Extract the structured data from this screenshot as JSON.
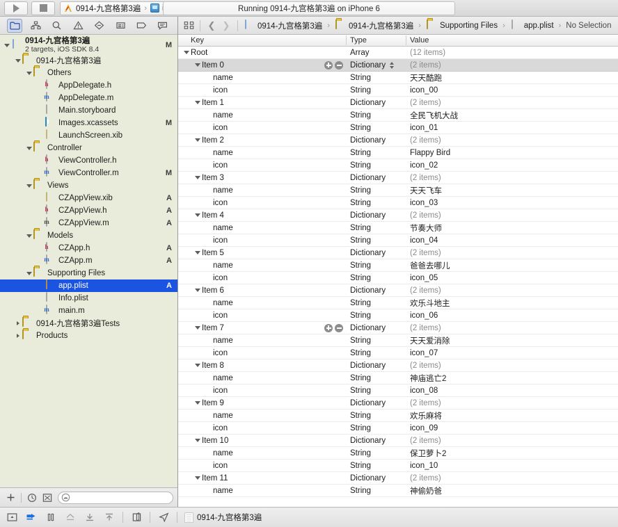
{
  "toolbar": {
    "run_label": "run-button",
    "stop_label": "stop-button",
    "scheme_project": "0914-九宫格第3遍",
    "scheme_destination": "iPhone 6",
    "status_text": "Running 0914-九宫格第3遍 on iPhone 6"
  },
  "navigator": {
    "tabs": [
      {
        "name": "project-navigator",
        "icon": "folder-icon"
      },
      {
        "name": "symbol-navigator",
        "icon": "symbol-icon"
      },
      {
        "name": "find-navigator",
        "icon": "search-icon"
      },
      {
        "name": "issue-navigator",
        "icon": "warning-icon"
      },
      {
        "name": "test-navigator",
        "icon": "diamond-icon"
      },
      {
        "name": "debug-navigator",
        "icon": "debug-icon"
      },
      {
        "name": "breakpoint-navigator",
        "icon": "breakpoint-icon"
      },
      {
        "name": "report-navigator",
        "icon": "report-icon"
      }
    ],
    "tree": [
      {
        "label": "0914-九宫格第3遍",
        "sub": "2 targets, iOS SDK 8.4",
        "indent": 0,
        "icon": "project-icon",
        "disclosure": "open",
        "status": "M",
        "bold": true
      },
      {
        "label": "0914-九宫格第3遍",
        "indent": 1,
        "icon": "folder-icon",
        "disclosure": "open",
        "status": ""
      },
      {
        "label": "Others",
        "indent": 2,
        "icon": "folder-icon",
        "disclosure": "open",
        "status": ""
      },
      {
        "label": "AppDelegate.h",
        "indent": 3,
        "icon": "h-file-icon",
        "disclosure": "none",
        "status": ""
      },
      {
        "label": "AppDelegate.m",
        "indent": 3,
        "icon": "m-file-icon",
        "disclosure": "none",
        "status": ""
      },
      {
        "label": "Main.storyboard",
        "indent": 3,
        "icon": "storyboard-icon",
        "disclosure": "none",
        "status": ""
      },
      {
        "label": "Images.xcassets",
        "indent": 3,
        "icon": "xcassets-icon",
        "disclosure": "none",
        "status": "M"
      },
      {
        "label": "LaunchScreen.xib",
        "indent": 3,
        "icon": "xib-icon",
        "disclosure": "none",
        "status": ""
      },
      {
        "label": "Controller",
        "indent": 2,
        "icon": "folder-icon",
        "disclosure": "open",
        "status": ""
      },
      {
        "label": "ViewController.h",
        "indent": 3,
        "icon": "h-file-icon",
        "disclosure": "none",
        "status": ""
      },
      {
        "label": "ViewController.m",
        "indent": 3,
        "icon": "m-file-icon",
        "disclosure": "none",
        "status": "M"
      },
      {
        "label": "Views",
        "indent": 2,
        "icon": "folder-icon",
        "disclosure": "open",
        "status": ""
      },
      {
        "label": "CZAppView.xib",
        "indent": 3,
        "icon": "xib-icon",
        "disclosure": "none",
        "status": "A"
      },
      {
        "label": "CZAppView.h",
        "indent": 3,
        "icon": "h-file-icon",
        "disclosure": "none",
        "status": "A"
      },
      {
        "label": "CZAppView.m",
        "indent": 3,
        "icon": "m-dark-icon",
        "disclosure": "none",
        "status": "A"
      },
      {
        "label": "Models",
        "indent": 2,
        "icon": "folder-icon",
        "disclosure": "open",
        "status": ""
      },
      {
        "label": "CZApp.h",
        "indent": 3,
        "icon": "h-file-icon",
        "disclosure": "none",
        "status": "A"
      },
      {
        "label": "CZApp.m",
        "indent": 3,
        "icon": "m-file-icon",
        "disclosure": "none",
        "status": "A"
      },
      {
        "label": "Supporting Files",
        "indent": 2,
        "icon": "folder-icon",
        "disclosure": "open",
        "status": ""
      },
      {
        "label": "app.plist",
        "indent": 3,
        "icon": "plist-icon",
        "disclosure": "none",
        "status": "A",
        "selected": true
      },
      {
        "label": "Info.plist",
        "indent": 3,
        "icon": "plist-gray-icon",
        "disclosure": "none",
        "status": ""
      },
      {
        "label": "main.m",
        "indent": 3,
        "icon": "m-file-icon",
        "disclosure": "none",
        "status": ""
      },
      {
        "label": "0914-九宫格第3遍Tests",
        "indent": 1,
        "icon": "folder-icon",
        "disclosure": "closed",
        "status": ""
      },
      {
        "label": "Products",
        "indent": 1,
        "icon": "folder-icon",
        "disclosure": "closed",
        "status": ""
      }
    ],
    "footer": {
      "add_label": "+",
      "recent_icon": "clock-icon",
      "filter_icon": "source-control-filter-icon",
      "filter_placeholder": ""
    }
  },
  "editor": {
    "jumpbar": {
      "related_icon": "related-items-icon",
      "back_icon": "back-arrow-icon",
      "forward_icon": "forward-arrow-icon",
      "breadcrumbs": [
        {
          "label": "0914-九宫格第3遍",
          "icon": "project-icon"
        },
        {
          "label": "0914-九宫格第3遍",
          "icon": "folder-icon"
        },
        {
          "label": "Supporting Files",
          "icon": "folder-icon"
        },
        {
          "label": "app.plist",
          "icon": "plist-gray-icon"
        },
        {
          "label": "No Selection",
          "icon": "none"
        }
      ]
    },
    "columns": {
      "key": "Key",
      "type": "Type",
      "value": "Value"
    },
    "rows": [
      {
        "key": "Root",
        "indent": 0,
        "type": "Array",
        "value": "(12 items)",
        "disclosure": "open",
        "muted": true
      },
      {
        "key": "Item 0",
        "indent": 1,
        "type": "Dictionary",
        "value": "(2 items)",
        "disclosure": "open",
        "muted": true,
        "highlight": true,
        "buttons": true,
        "stepper": true
      },
      {
        "key": "name",
        "indent": 2,
        "type": "String",
        "value": "天天酷跑"
      },
      {
        "key": "icon",
        "indent": 2,
        "type": "String",
        "value": "icon_00"
      },
      {
        "key": "Item 1",
        "indent": 1,
        "type": "Dictionary",
        "value": "(2 items)",
        "disclosure": "open",
        "muted": true
      },
      {
        "key": "name",
        "indent": 2,
        "type": "String",
        "value": "全民飞机大战"
      },
      {
        "key": "icon",
        "indent": 2,
        "type": "String",
        "value": "icon_01"
      },
      {
        "key": "Item 2",
        "indent": 1,
        "type": "Dictionary",
        "value": "(2 items)",
        "disclosure": "open",
        "muted": true
      },
      {
        "key": "name",
        "indent": 2,
        "type": "String",
        "value": "Flappy Bird"
      },
      {
        "key": "icon",
        "indent": 2,
        "type": "String",
        "value": "icon_02"
      },
      {
        "key": "Item 3",
        "indent": 1,
        "type": "Dictionary",
        "value": "(2 items)",
        "disclosure": "open",
        "muted": true
      },
      {
        "key": "name",
        "indent": 2,
        "type": "String",
        "value": "天天飞车"
      },
      {
        "key": "icon",
        "indent": 2,
        "type": "String",
        "value": "icon_03"
      },
      {
        "key": "Item 4",
        "indent": 1,
        "type": "Dictionary",
        "value": "(2 items)",
        "disclosure": "open",
        "muted": true
      },
      {
        "key": "name",
        "indent": 2,
        "type": "String",
        "value": "节奏大师"
      },
      {
        "key": "icon",
        "indent": 2,
        "type": "String",
        "value": "icon_04"
      },
      {
        "key": "Item 5",
        "indent": 1,
        "type": "Dictionary",
        "value": "(2 items)",
        "disclosure": "open",
        "muted": true
      },
      {
        "key": "name",
        "indent": 2,
        "type": "String",
        "value": "爸爸去哪儿"
      },
      {
        "key": "icon",
        "indent": 2,
        "type": "String",
        "value": "icon_05"
      },
      {
        "key": "Item 6",
        "indent": 1,
        "type": "Dictionary",
        "value": "(2 items)",
        "disclosure": "open",
        "muted": true
      },
      {
        "key": "name",
        "indent": 2,
        "type": "String",
        "value": "欢乐斗地主"
      },
      {
        "key": "icon",
        "indent": 2,
        "type": "String",
        "value": "icon_06"
      },
      {
        "key": "Item 7",
        "indent": 1,
        "type": "Dictionary",
        "value": "(2 items)",
        "disclosure": "open",
        "muted": true,
        "buttons": true
      },
      {
        "key": "name",
        "indent": 2,
        "type": "String",
        "value": "天天爱消除"
      },
      {
        "key": "icon",
        "indent": 2,
        "type": "String",
        "value": "icon_07"
      },
      {
        "key": "Item 8",
        "indent": 1,
        "type": "Dictionary",
        "value": "(2 items)",
        "disclosure": "open",
        "muted": true
      },
      {
        "key": "name",
        "indent": 2,
        "type": "String",
        "value": "神庙逃亡2"
      },
      {
        "key": "icon",
        "indent": 2,
        "type": "String",
        "value": "icon_08"
      },
      {
        "key": "Item 9",
        "indent": 1,
        "type": "Dictionary",
        "value": "(2 items)",
        "disclosure": "open",
        "muted": true
      },
      {
        "key": "name",
        "indent": 2,
        "type": "String",
        "value": "欢乐麻将"
      },
      {
        "key": "icon",
        "indent": 2,
        "type": "String",
        "value": "icon_09"
      },
      {
        "key": "Item 10",
        "indent": 1,
        "type": "Dictionary",
        "value": "(2 items)",
        "disclosure": "open",
        "muted": true
      },
      {
        "key": "name",
        "indent": 2,
        "type": "String",
        "value": "保卫萝卜2"
      },
      {
        "key": "icon",
        "indent": 2,
        "type": "String",
        "value": "icon_10"
      },
      {
        "key": "Item 11",
        "indent": 1,
        "type": "Dictionary",
        "value": "(2 items)",
        "disclosure": "open",
        "muted": true
      },
      {
        "key": "name",
        "indent": 2,
        "type": "String",
        "value": "神偷奶爸"
      }
    ]
  },
  "debugbar": {
    "buttons": [
      {
        "name": "hide-debug-area-button",
        "icon": "debug-area-icon"
      },
      {
        "name": "step-over-button",
        "icon": "step-over-icon"
      },
      {
        "name": "pause-button",
        "icon": "pause-icon"
      },
      {
        "name": "step-into-button",
        "icon": "step-into-icon"
      },
      {
        "name": "step-out-button",
        "icon": "step-out-icon"
      },
      {
        "name": "step-up-button",
        "icon": "step-up-icon"
      },
      {
        "name": "view-hierarchy-button",
        "icon": "view-hierarchy-icon"
      },
      {
        "name": "simulate-location-button",
        "icon": "location-arrow-icon"
      }
    ],
    "process_label": "0914-九宫格第3遍"
  },
  "colors": {
    "selection_blue": "#1b54e0",
    "navigator_bg": "#e9ecda",
    "row_highlight": "#d9d9d9",
    "accent_blue": "#1a6fe0"
  }
}
